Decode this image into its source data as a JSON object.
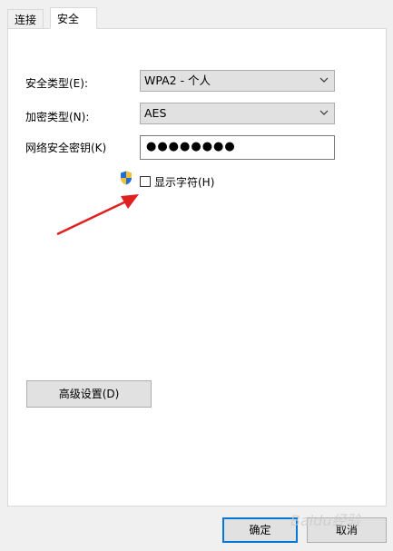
{
  "tabs": [
    {
      "label": "连接"
    },
    {
      "label": "安全"
    }
  ],
  "security_type": {
    "label": "安全类型(E):",
    "value": "WPA2 - 个人"
  },
  "encryption_type": {
    "label": "加密类型(N):",
    "value": "AES"
  },
  "network_key": {
    "label": "网络安全密钥(K)",
    "value": "●●●●●●●●"
  },
  "show_chars": {
    "label": "显示字符(H)",
    "checked": false
  },
  "advanced_button": "高级设置(D)",
  "ok_button": "确定",
  "cancel_button": "取消",
  "watermark": "Baidu经验",
  "colors": {
    "accent": "#0078d7",
    "annotation_arrow": "#e02020",
    "shield_blue": "#1e6fd9",
    "shield_yellow": "#f2c230"
  },
  "icons": {
    "shield": "uac-shield-icon",
    "dropdown": "chevron-down-icon"
  }
}
